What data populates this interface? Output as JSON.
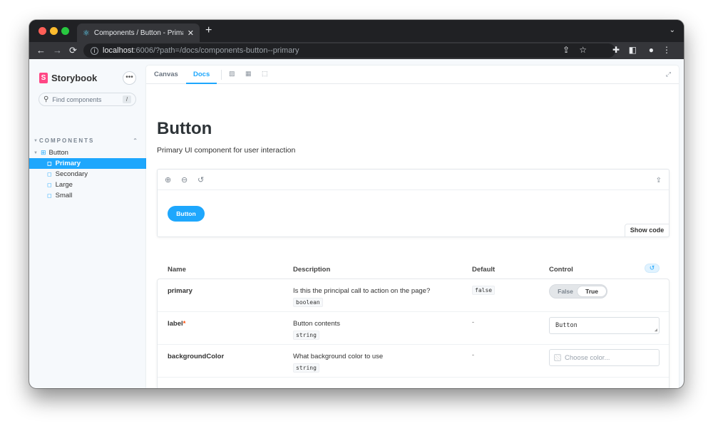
{
  "browser": {
    "tab_title": "Components / Button - Primary",
    "tab_icon": "react-icon",
    "url_host": "localhost",
    "url_rest": ":6006/?path=/docs/components-button--primary"
  },
  "sidebar": {
    "brand": "Storybook",
    "search_placeholder": "Find components",
    "search_shortcut": "/",
    "section": "COMPONENTS",
    "component": "Button",
    "stories": [
      {
        "label": "Primary",
        "selected": true
      },
      {
        "label": "Secondary",
        "selected": false
      },
      {
        "label": "Large",
        "selected": false
      },
      {
        "label": "Small",
        "selected": false
      }
    ]
  },
  "topbar": {
    "tabs": [
      "Canvas",
      "Docs"
    ],
    "active_tab": "Docs"
  },
  "docs": {
    "title": "Button",
    "subtitle": "Primary UI component for user interaction",
    "preview_button_label": "Button",
    "show_code": "Show code"
  },
  "args_table": {
    "headers": {
      "name": "Name",
      "description": "Description",
      "default": "Default",
      "control": "Control"
    },
    "rows": [
      {
        "name": "primary",
        "required": false,
        "description": "Is this the principal call to action on the page?",
        "type": "boolean",
        "default": "false",
        "control": {
          "kind": "toggle",
          "off_label": "False",
          "on_label": "True",
          "value": true
        }
      },
      {
        "name": "label",
        "required": true,
        "required_mark": "*",
        "description": "Button contents",
        "type": "string",
        "default": "-",
        "control": {
          "kind": "text",
          "value": "Button"
        }
      },
      {
        "name": "backgroundColor",
        "required": false,
        "description": "What background color to use",
        "type": "string",
        "default": "-",
        "control": {
          "kind": "color",
          "placeholder": "Choose color..."
        }
      }
    ]
  },
  "colors": {
    "accent": "#1ea7fd",
    "brand": "#ff4785",
    "required": "#ff4400"
  }
}
